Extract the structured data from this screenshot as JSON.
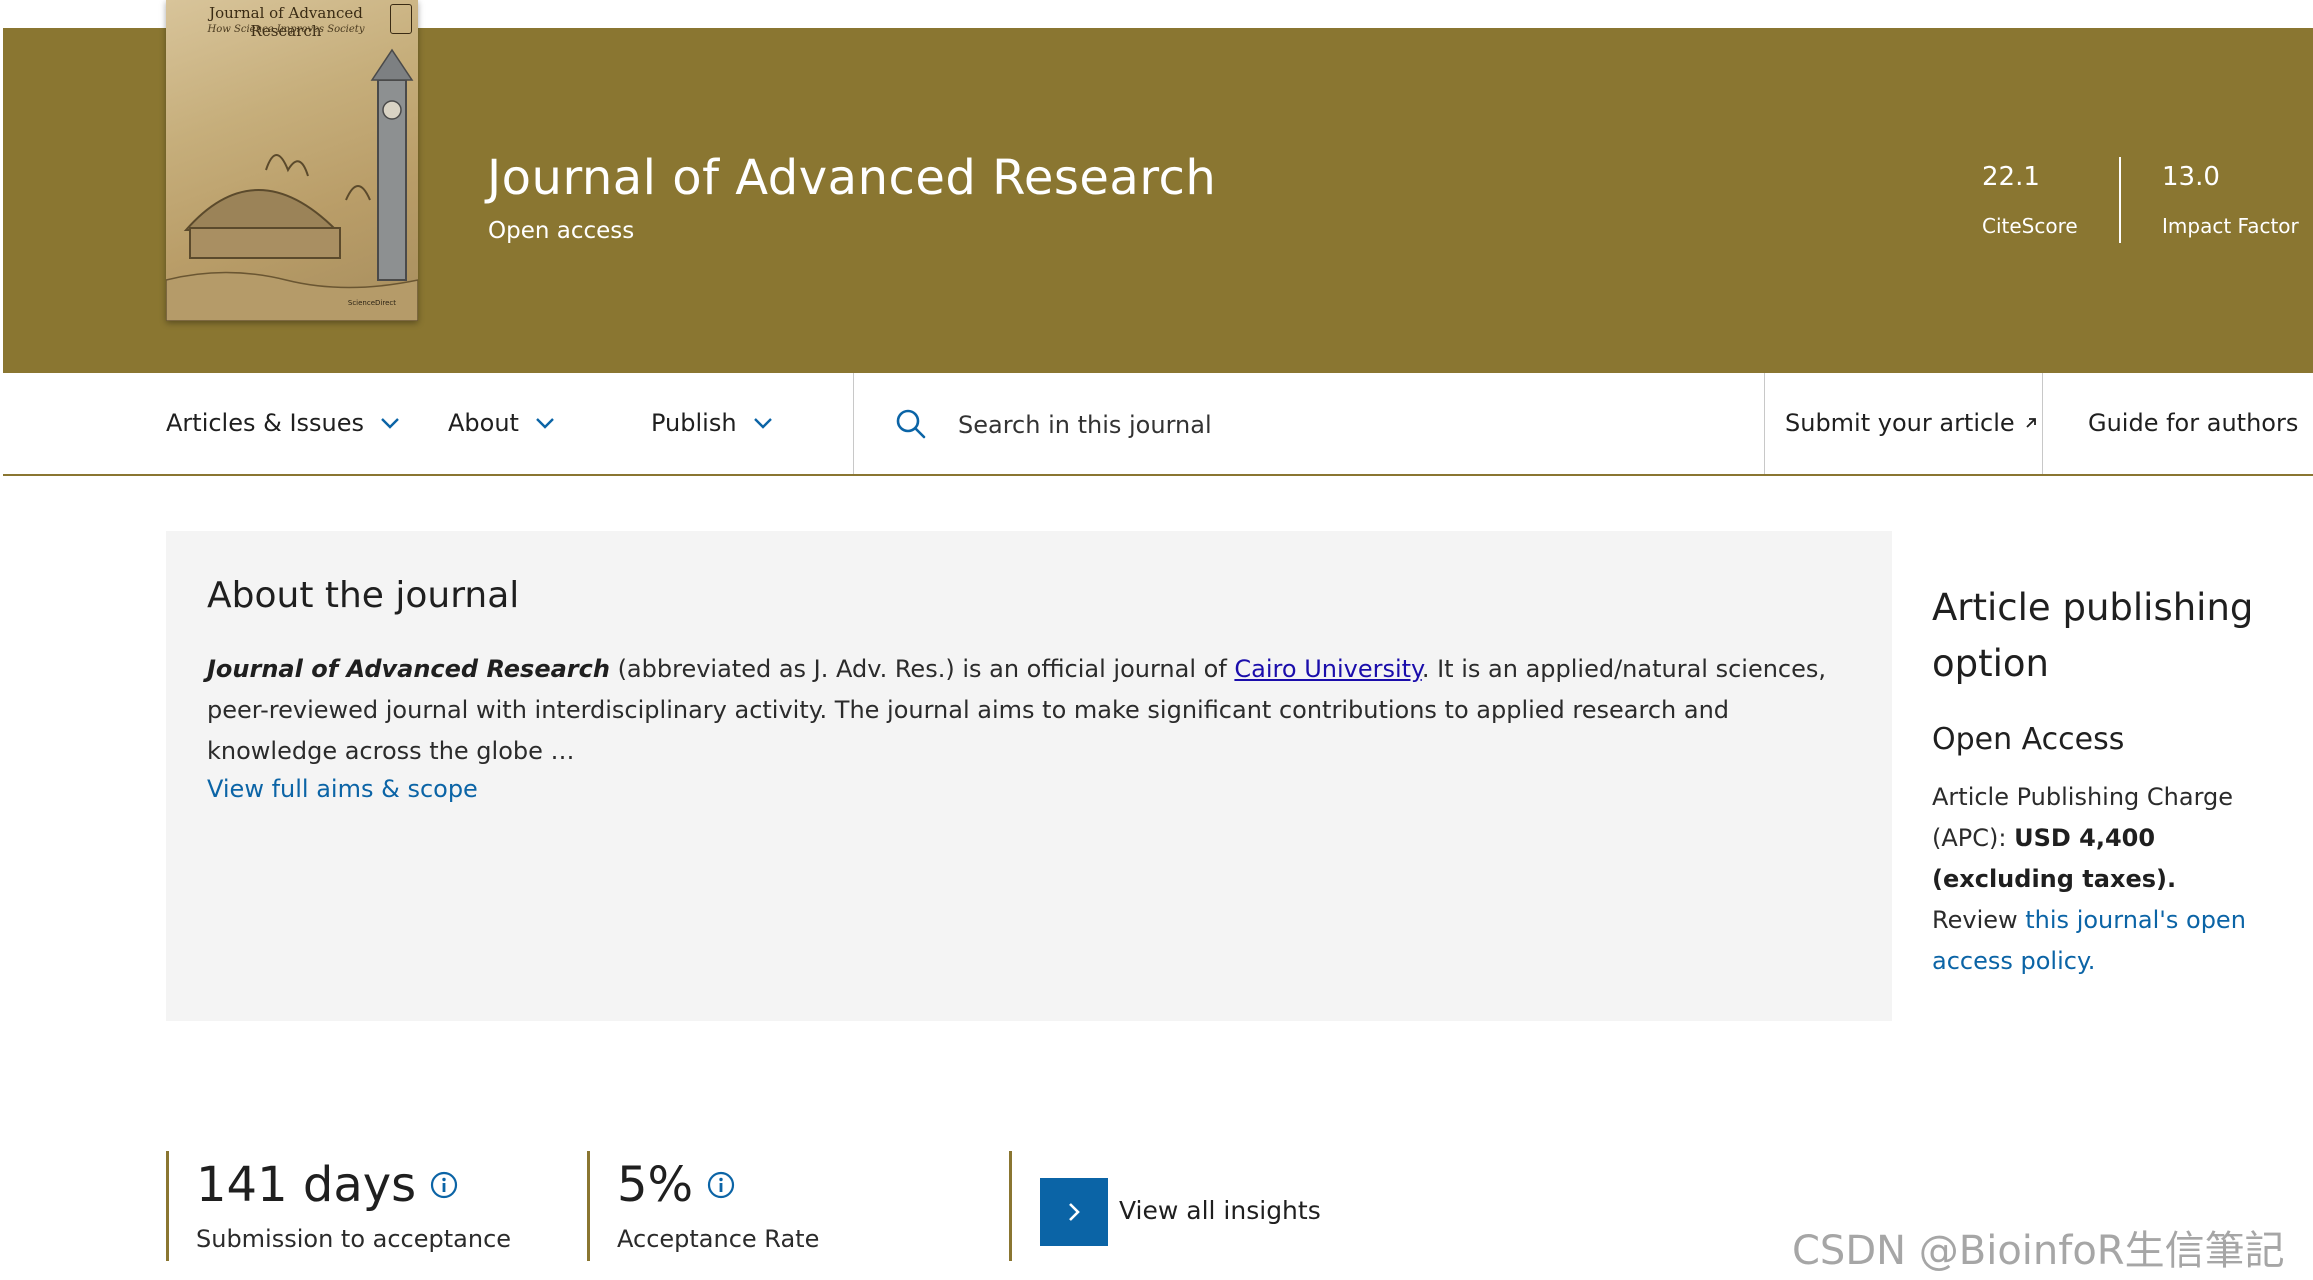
{
  "cover": {
    "title": "Journal of Advanced Research",
    "subtitle": "How Science Improves Society",
    "brand": "ScienceDirect"
  },
  "header": {
    "journal_title": "Journal of Advanced Research",
    "access_type": "Open access",
    "metrics": [
      {
        "value": "22.1",
        "label": "CiteScore"
      },
      {
        "value": "13.0",
        "label": "Impact Factor"
      }
    ],
    "banner_color": "#8a7631"
  },
  "nav": {
    "items": [
      {
        "label": "Articles & Issues"
      },
      {
        "label": "About"
      },
      {
        "label": "Publish"
      }
    ],
    "search_placeholder": "Search in this journal",
    "submit_label": "Submit your article",
    "guide_label": "Guide for authors"
  },
  "about": {
    "title": "About the journal",
    "journal_name": "Journal of Advanced Research",
    "text_1": " (abbreviated as J. Adv. Res.) is an official journal of ",
    "university_link": "Cairo University",
    "text_2": ". It is an applied/natural sciences, peer-reviewed journal with interdisciplinary activity. The journal aims to make significant contributions to applied research and knowledge across the globe …",
    "scope_link": "View full aims & scope"
  },
  "side": {
    "title": "Article publishing option",
    "option": "Open Access",
    "apc_prefix": "Article Publishing Charge (APC): ",
    "apc_value": "USD 4,400 (excluding taxes).",
    "review_prefix": "Review ",
    "policy_link": "this journal's open access policy."
  },
  "insights": {
    "items": [
      {
        "value": "141 days",
        "label": "Submission to acceptance"
      },
      {
        "value": "5%",
        "label": "Acceptance Rate"
      }
    ],
    "view_all": "View all insights"
  },
  "watermark": "CSDN @BioinfoR生信筆記",
  "colors": {
    "accent": "#8a7631",
    "link": "#0b64a6"
  }
}
